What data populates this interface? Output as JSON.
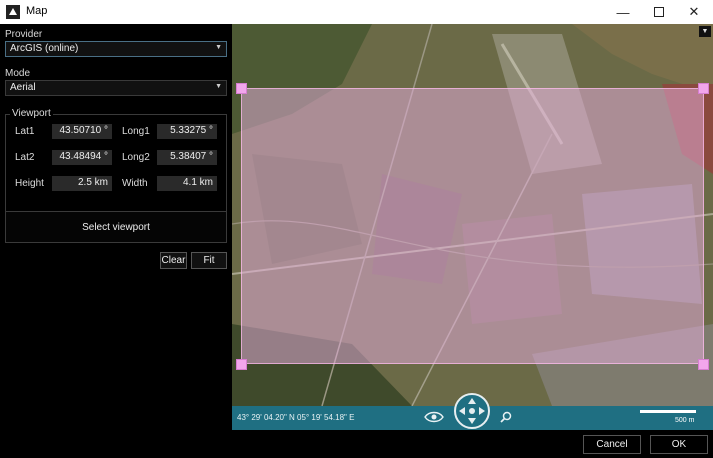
{
  "window": {
    "title": "Map"
  },
  "panel": {
    "provider_label": "Provider",
    "provider_value": "ArcGIS (online)",
    "mode_label": "Mode",
    "mode_value": "Aerial",
    "viewport": {
      "title": "Viewport",
      "lat1_label": "Lat1",
      "lat1_value": "43.50710 °",
      "long1_label": "Long1",
      "long1_value": "5.33275 °",
      "lat2_label": "Lat2",
      "lat2_value": "43.48494 °",
      "long2_label": "Long2",
      "long2_value": "5.38407 °",
      "height_label": "Height",
      "height_value": "2.5 km",
      "width_label": "Width",
      "width_value": "4.1 km"
    },
    "select_viewport": "Select viewport",
    "clear": "Clear",
    "fit": "Fit"
  },
  "map": {
    "coordinates": "43° 29' 04.20\" N 05° 19' 54.18\" E",
    "scale_label": "500 m",
    "viewport_color": "#e6afdc",
    "toolbar_color": "#1f6f82"
  },
  "footer": {
    "cancel": "Cancel",
    "ok": "OK"
  }
}
